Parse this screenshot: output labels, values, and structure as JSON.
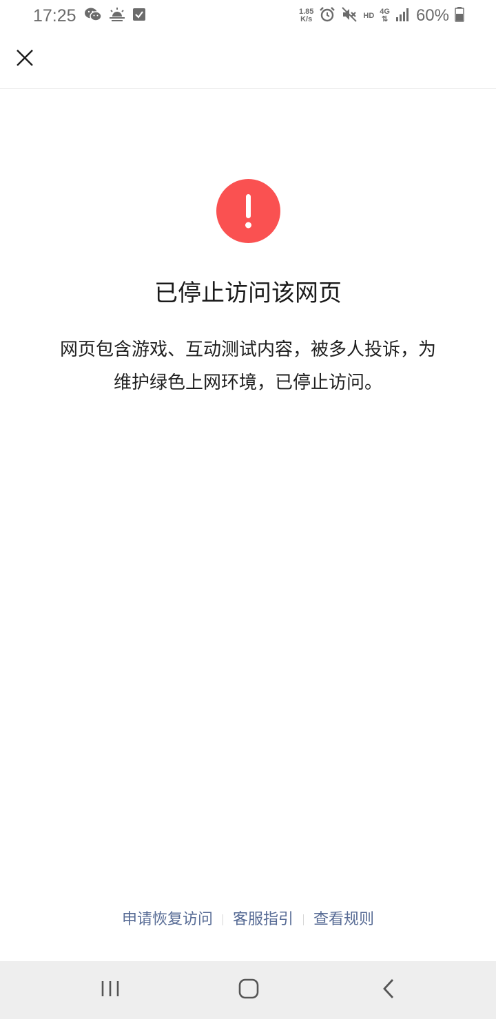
{
  "status_bar": {
    "time": "17:25",
    "net_speed_value": "1.85",
    "net_speed_unit": "K/s",
    "hd_label": "HD",
    "network_label": "4G",
    "battery_percent": "60%",
    "left_icons": [
      "wechat-icon",
      "weather-icon",
      "checkbox-icon"
    ],
    "right_icons": [
      "alarm-icon",
      "mute-icon",
      "signal-icon",
      "battery-icon"
    ]
  },
  "header": {
    "close_icon": "close-icon"
  },
  "main": {
    "alert_icon": "exclamation-icon",
    "alert_color": "#fa5151",
    "title": "已停止访问该网页",
    "description_line1": "网页包含游戏、互动测试内容，被多人投诉，为",
    "description_line2": "维护绿色上网环境，已停止访问。"
  },
  "footer": {
    "link_color": "#576b95",
    "links": [
      {
        "label": "申请恢复访问"
      },
      {
        "label": "客服指引"
      },
      {
        "label": "查看规则"
      }
    ]
  },
  "nav_bar": {
    "icons": [
      "recent-apps-icon",
      "home-icon",
      "back-icon"
    ]
  }
}
